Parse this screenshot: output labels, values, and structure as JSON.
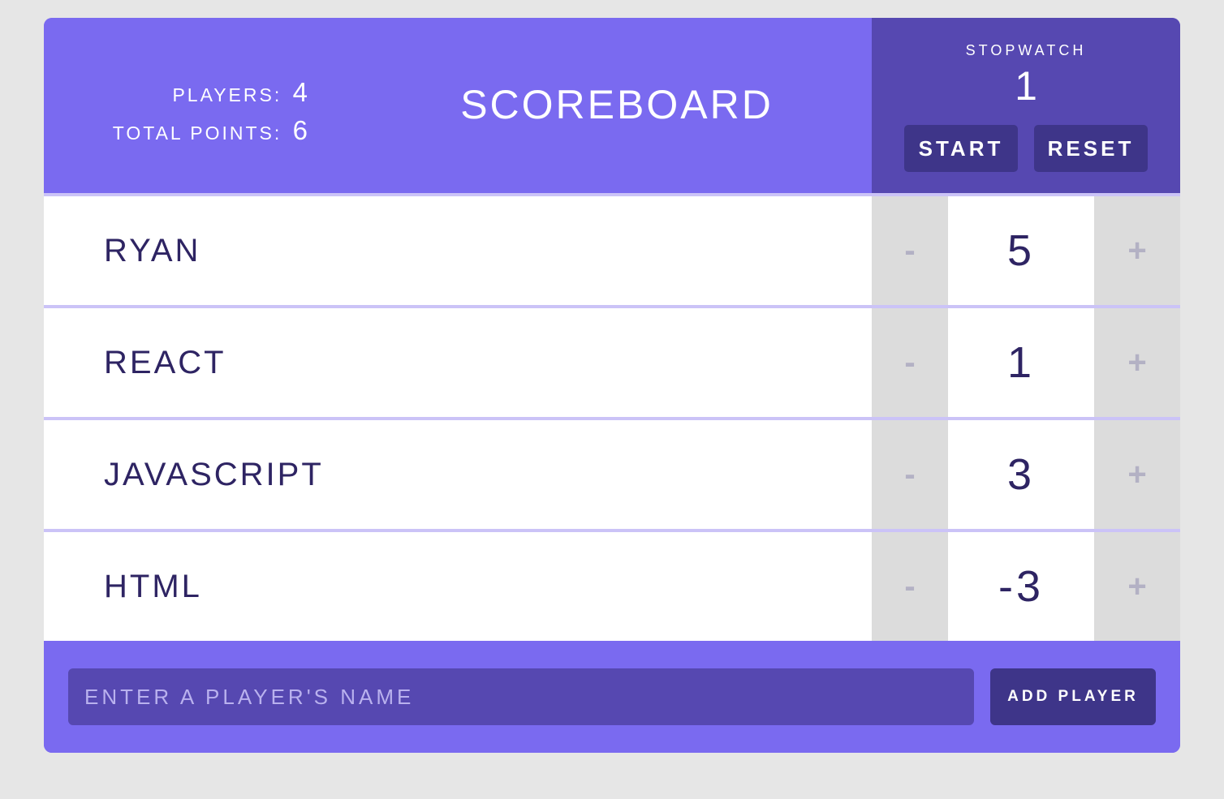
{
  "header": {
    "players_label": "PLAYERS:",
    "players_count": "4",
    "points_label": "TOTAL POINTS:",
    "points_total": "6",
    "title": "SCOREBOARD"
  },
  "stopwatch": {
    "label": "STOPWATCH",
    "time": "1",
    "start_label": "START",
    "reset_label": "RESET"
  },
  "players": [
    {
      "name": "RYAN",
      "score": "5",
      "dec_label": "-",
      "inc_label": "+"
    },
    {
      "name": "REACT",
      "score": "1",
      "dec_label": "-",
      "inc_label": "+"
    },
    {
      "name": "JAVASCRIPT",
      "score": "3",
      "dec_label": "-",
      "inc_label": "+"
    },
    {
      "name": "HTML",
      "score": "-3",
      "dec_label": "-",
      "inc_label": "+"
    }
  ],
  "form": {
    "input_value": "",
    "input_placeholder": "ENTER A PLAYER'S NAME",
    "add_label": "ADD PLAYER"
  },
  "colors": {
    "primary": "#7a6af0",
    "dark": "#5648b1",
    "darker": "#3e3589",
    "text": "#2e2463"
  }
}
